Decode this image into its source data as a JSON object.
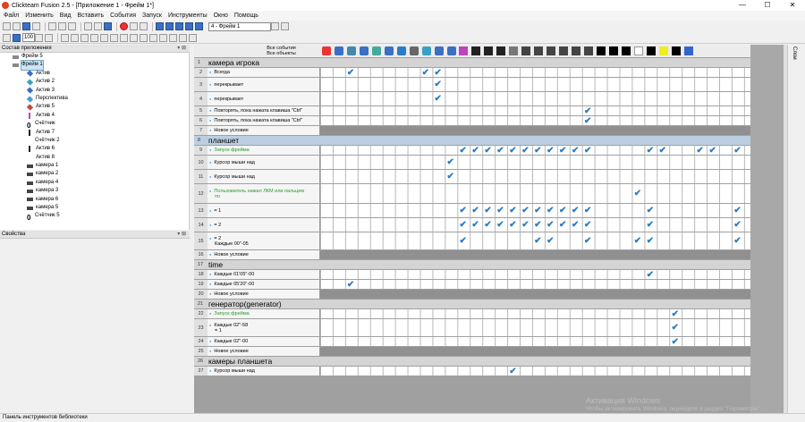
{
  "window": {
    "title": "Clickteam Fusion 2.5 - [Приложение 1 - Фрейм 1*]",
    "min": "—",
    "max": "☐",
    "close": "✕"
  },
  "menu": [
    "Файл",
    "Изменить",
    "Вид",
    "Вставить",
    "События",
    "Запуск",
    "Инструменты",
    "Окно",
    "Помощь"
  ],
  "toolbar": {
    "frame_select": "4 - Фрейм 1",
    "zoom": "100"
  },
  "workspace": {
    "title": "Состав приложения",
    "pin": "▾ ⊠",
    "nodes": [
      {
        "label": "Фрейм 5",
        "icon": "frame-icon",
        "color": "#888"
      },
      {
        "label": "Фрейм 1",
        "icon": "frame-icon",
        "color": "#888",
        "selected": true
      },
      {
        "label": "Актив",
        "icon": "active-icon",
        "color": "#3a6fc4"
      },
      {
        "label": "Актив 2",
        "icon": "active-icon",
        "color": "#3aa0c4"
      },
      {
        "label": "Актив 3",
        "icon": "active-icon",
        "color": "#3a6fc4"
      },
      {
        "label": "Перспектива",
        "icon": "perspective-icon",
        "color": "#3a9fd9"
      },
      {
        "label": "Актив 5",
        "icon": "active-icon",
        "color": "#c44"
      },
      {
        "label": "Актив 4",
        "icon": "bar-icon",
        "color": "#b4b"
      },
      {
        "label": "Счётчик",
        "icon": "counter-icon",
        "color": "#000"
      },
      {
        "label": "Актив 7",
        "icon": "bar-icon",
        "color": "#222"
      },
      {
        "label": "Счётчик 2",
        "icon": "counter-icon",
        "color": "#fff"
      },
      {
        "label": "Актив 6",
        "icon": "bar-icon",
        "color": "#222"
      },
      {
        "label": "Актив 8",
        "icon": "bar-icon",
        "color": "#fff"
      },
      {
        "label": "камера 1",
        "icon": "camera-icon",
        "color": "#444"
      },
      {
        "label": "камера 2",
        "icon": "camera-icon",
        "color": "#444"
      },
      {
        "label": "камера 4",
        "icon": "camera-icon",
        "color": "#444"
      },
      {
        "label": "камера 3",
        "icon": "camera-icon",
        "color": "#444"
      },
      {
        "label": "камера 6",
        "icon": "camera-icon",
        "color": "#444"
      },
      {
        "label": "камера 5",
        "icon": "camera-icon",
        "color": "#444"
      },
      {
        "label": "Счётчик 5",
        "icon": "counter-icon",
        "color": "#000"
      }
    ]
  },
  "properties": {
    "title": "Свойства"
  },
  "status": "Панель инструментов библиотеки",
  "editor": {
    "header_all_events": "Все события",
    "header_all_objects": "Все объекты"
  },
  "right_tab": "Слои",
  "watermark": {
    "line1": "Активация Windows",
    "line2": "Чтобы активировать Windows, перейдите в раздел \"Параметры\"."
  },
  "events": [
    {
      "type": "group",
      "num": "1",
      "label": "камера игрока"
    },
    {
      "type": "row",
      "num": "2",
      "lines": [
        "Всегда"
      ],
      "checks": [
        2,
        8,
        9
      ]
    },
    {
      "type": "row",
      "num": "3",
      "lines": [
        "перекрывает"
      ],
      "checks": [
        9
      ],
      "h": 16
    },
    {
      "type": "row",
      "num": "4",
      "lines": [
        "перекрывает"
      ],
      "checks": [
        9
      ],
      "h": 16
    },
    {
      "type": "row",
      "num": "5",
      "lines": [
        "Повторять, пока нажата клавиша \"Ctrl\""
      ],
      "checks": [
        21
      ]
    },
    {
      "type": "row",
      "num": "6",
      "lines": [
        "Повторять, пока нажата клавиша \"Ctrl\""
      ],
      "checks": [
        21
      ]
    },
    {
      "type": "new",
      "num": "7",
      "lines": [
        "Новое условие"
      ]
    },
    {
      "type": "group",
      "num": "8",
      "label": "планшет",
      "blue": true
    },
    {
      "type": "row",
      "num": "9",
      "lines": [
        "Запуск фрейма"
      ],
      "green": true,
      "checks": [
        11,
        12,
        13,
        14,
        15,
        16,
        17,
        18,
        19,
        20,
        21,
        26,
        27,
        30,
        31,
        33
      ]
    },
    {
      "type": "row",
      "num": "10",
      "lines": [
        "Курсор мыши над"
      ],
      "checks": [
        10
      ],
      "h": 16
    },
    {
      "type": "row",
      "num": "11",
      "lines": [
        "Курсор мыши над"
      ],
      "checks": [
        10
      ],
      "h": 16
    },
    {
      "type": "row",
      "num": "12",
      "lines": [
        "Пользователь нажал ЛКМ или пальцем",
        "по"
      ],
      "green": true,
      "checks": [
        25
      ],
      "h": 22
    },
    {
      "type": "row",
      "num": "13",
      "lines": [
        "= 1"
      ],
      "checks": [
        11,
        12,
        13,
        14,
        15,
        16,
        17,
        18,
        19,
        20,
        21,
        26,
        33
      ],
      "h": 16
    },
    {
      "type": "row",
      "num": "14",
      "lines": [
        "= 2"
      ],
      "checks": [
        11,
        12,
        13,
        14,
        15,
        16,
        17,
        18,
        19,
        20,
        21,
        26,
        33
      ],
      "h": 16
    },
    {
      "type": "row",
      "num": "15",
      "lines": [
        "= 2",
        "Каждые 00\"-05"
      ],
      "checks": [
        11,
        17,
        18,
        21,
        25,
        26,
        33
      ],
      "h": 20
    },
    {
      "type": "new",
      "num": "16",
      "lines": [
        "Новое условие"
      ]
    },
    {
      "type": "group",
      "num": "17",
      "label": "time"
    },
    {
      "type": "row",
      "num": "18",
      "lines": [
        "Каждые 01'05\"-00"
      ],
      "checks": [
        26
      ]
    },
    {
      "type": "row",
      "num": "19",
      "lines": [
        "Каждые 05'20\"-00"
      ],
      "checks": [
        2
      ]
    },
    {
      "type": "new",
      "num": "20",
      "lines": [
        "Новое условие"
      ]
    },
    {
      "type": "group",
      "num": "21",
      "label": "генератор(generator)"
    },
    {
      "type": "row",
      "num": "22",
      "lines": [
        "Запуск фрейма"
      ],
      "green": true,
      "checks": [
        28
      ]
    },
    {
      "type": "row",
      "num": "23",
      "lines": [
        "Каждые 02\"-58",
        "= 1"
      ],
      "checks": [
        28
      ],
      "h": 20
    },
    {
      "type": "row",
      "num": "24",
      "lines": [
        "Каждые 02\"-00"
      ],
      "checks": [
        28
      ]
    },
    {
      "type": "new",
      "num": "25",
      "lines": [
        "Новое условие"
      ]
    },
    {
      "type": "group",
      "num": "26",
      "label": "камеры планшета"
    },
    {
      "type": "row",
      "num": "27",
      "lines": [
        "Курсор мыши над"
      ],
      "checks": [
        15
      ]
    }
  ]
}
